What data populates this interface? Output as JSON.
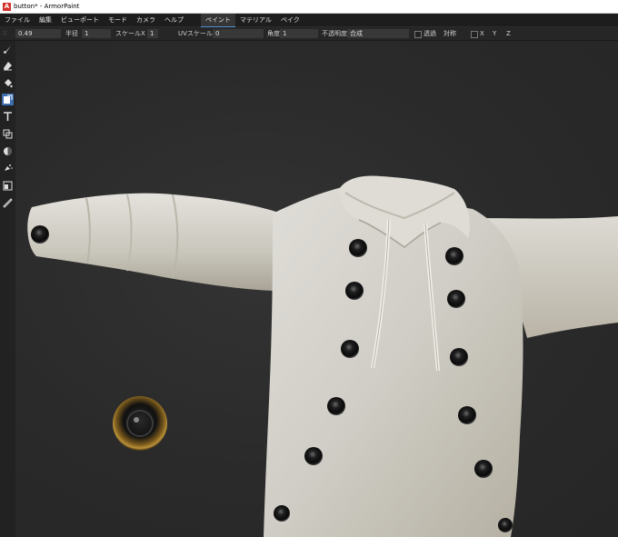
{
  "window": {
    "title": "button* - ArmorPaint",
    "app_icon_letter": "A"
  },
  "menu": {
    "items": [
      "ファイル",
      "編集",
      "ビューポート",
      "モード",
      "カメラ",
      "ヘルプ"
    ],
    "tabs": [
      "ペイント",
      "マテリアル",
      "ベイク"
    ],
    "active_tab": "ペイント"
  },
  "tool_options": {
    "value_049": "0.49",
    "radius_label": "半径",
    "radius_value": "1",
    "scale_x_label": "スケールX",
    "scale_x_value": "1",
    "uv_scale_label": "UVスケール",
    "uv_scale_value": "0",
    "angle_label": "角度",
    "angle_value": "1",
    "opacity_label": "不透明度",
    "blend_value": "合成",
    "transparent_label": "透過",
    "symmetry_label": "対称",
    "x_label": "X",
    "y_label": "Y",
    "z_label": "Z"
  },
  "tools": [
    "brush-icon",
    "eraser-icon",
    "fill-icon",
    "decal-icon",
    "text-icon",
    "clone-icon",
    "blur-icon",
    "particle-icon",
    "bake-icon",
    "picker-icon"
  ],
  "active_tool": "decal-icon",
  "colors": {
    "accent": "#3d6fb0",
    "fabric": "#d6d4cc",
    "button_metal": "#2a2a2a",
    "rim_gold": "#7a5a1c"
  }
}
